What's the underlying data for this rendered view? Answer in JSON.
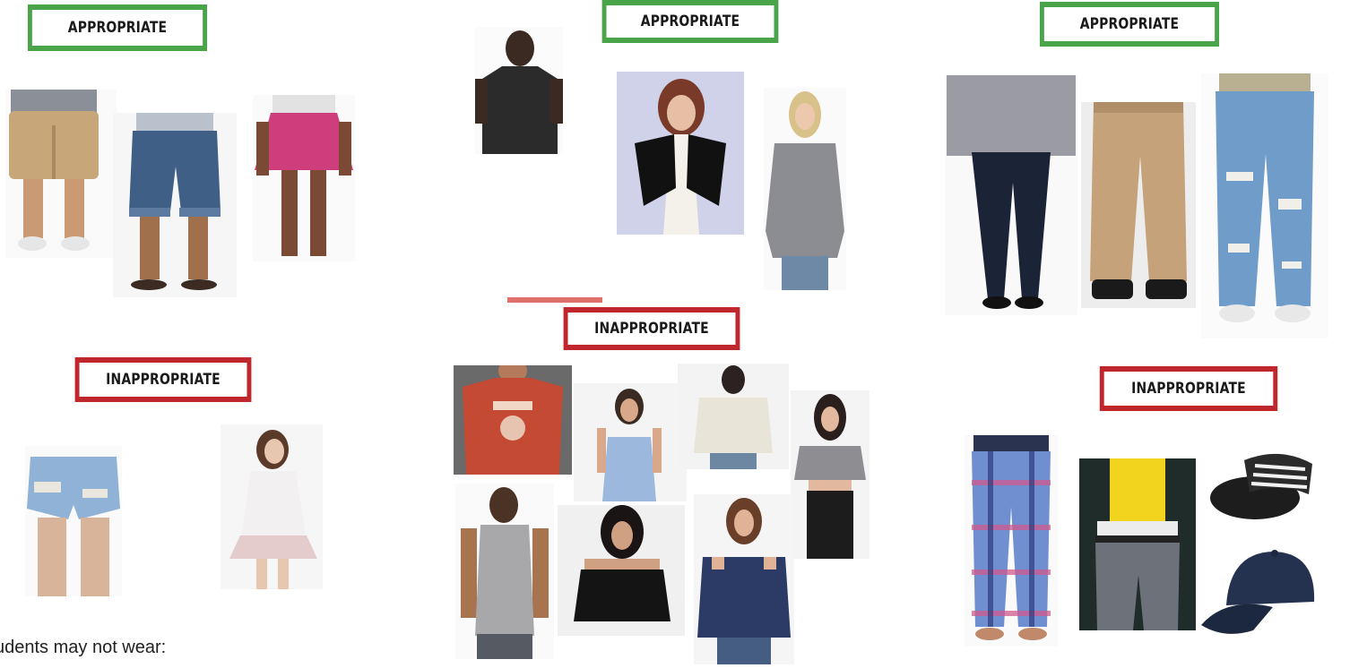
{
  "colors": {
    "appropriate_border": "#4aa54a",
    "inappropriate_border": "#c0272d"
  },
  "labels": {
    "appropriate_1": "APPROPRIATE",
    "appropriate_2": "APPROPRIATE",
    "appropriate_3": "APPROPRIATE",
    "inappropriate_1": "INAPPROPRIATE",
    "inappropriate_2": "INAPPROPRIATE",
    "inappropriate_3": "INAPPROPRIATE"
  },
  "caption": "udents may not wear:",
  "images": [
    {
      "icon": "khaki-shorts-photo"
    },
    {
      "icon": "denim-bermuda-shorts-photo"
    },
    {
      "icon": "pink-skirt-photo"
    },
    {
      "icon": "black-tshirt-photo"
    },
    {
      "icon": "black-shrug-photo"
    },
    {
      "icon": "grey-top-photo"
    },
    {
      "icon": "leggings-photo"
    },
    {
      "icon": "khaki-pants-photo"
    },
    {
      "icon": "ripped-jeans-photo"
    },
    {
      "icon": "denim-cutoff-shorts-photo"
    },
    {
      "icon": "white-mini-dress-photo"
    },
    {
      "icon": "graphic-tshirt-photo"
    },
    {
      "icon": "halter-top-photo"
    },
    {
      "icon": "sheer-top-photo"
    },
    {
      "icon": "crop-top-photo"
    },
    {
      "icon": "tank-top-photo"
    },
    {
      "icon": "off-shoulder-top-photo"
    },
    {
      "icon": "cold-shoulder-top-photo"
    },
    {
      "icon": "pajama-pants-photo"
    },
    {
      "icon": "sagging-pants-photo"
    },
    {
      "icon": "slide-sandals-photo"
    },
    {
      "icon": "baseball-cap-photo"
    }
  ]
}
